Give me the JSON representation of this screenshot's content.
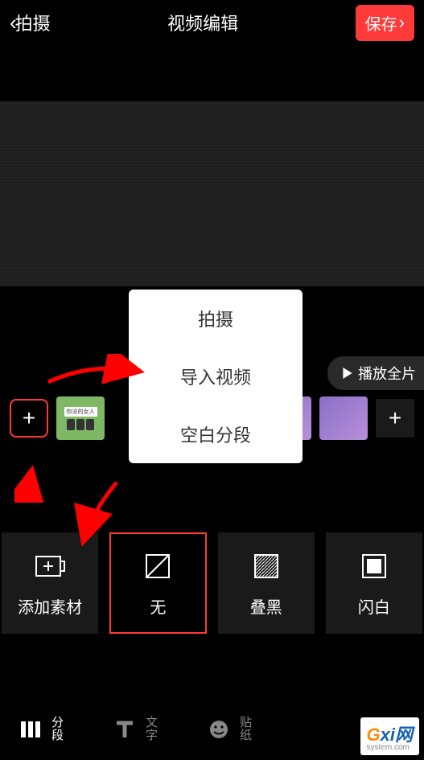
{
  "header": {
    "back_label": "拍摄",
    "title": "视频编辑",
    "save_label": "保存"
  },
  "play_full_label": "播放全片",
  "popup": {
    "items": [
      "拍摄",
      "导入视频",
      "空白分段"
    ]
  },
  "timeline": {
    "thumb1_text": "你没的女人"
  },
  "transitions": {
    "items": [
      {
        "label": "添加素材"
      },
      {
        "label": "无"
      },
      {
        "label": "叠黑"
      },
      {
        "label": "闪白"
      }
    ]
  },
  "bottom_nav": {
    "items": [
      {
        "line1": "分",
        "line2": "段"
      },
      {
        "line1": "文",
        "line2": "字"
      },
      {
        "line1": "贴",
        "line2": "纸"
      }
    ]
  },
  "watermark": {
    "brand": "Gxi网",
    "sub": "system.com"
  }
}
